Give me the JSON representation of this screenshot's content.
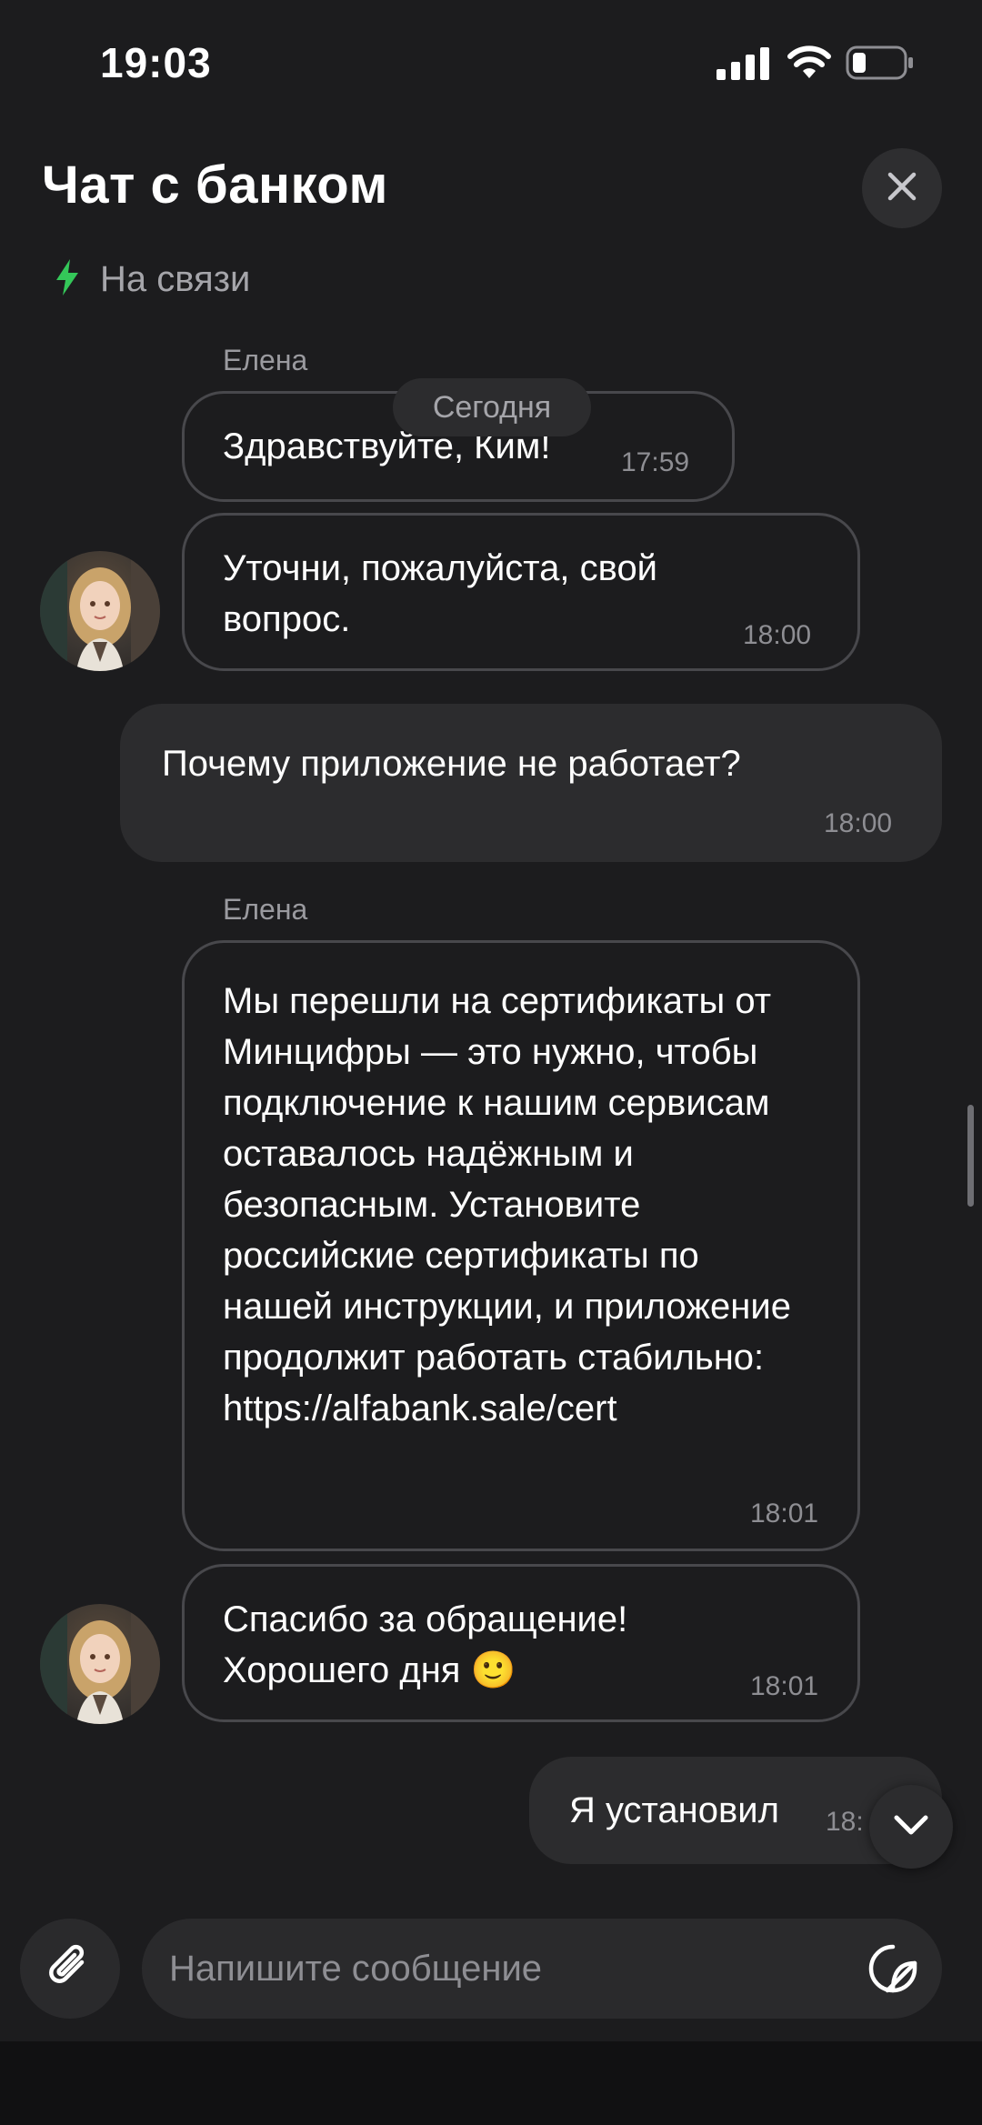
{
  "status_bar": {
    "time": "19:03"
  },
  "header": {
    "title": "Чат с банком",
    "status": "На связи"
  },
  "chat": {
    "date_chip": "Сегодня",
    "sender": "Елена",
    "messages": [
      {
        "from": "bank",
        "text": "Здравствуйте, Ким!",
        "time": "17:59"
      },
      {
        "from": "bank",
        "text": "Уточни, пожалуйста, свой вопрос.",
        "time": "18:00"
      },
      {
        "from": "me",
        "text": "Почему приложение не работает?",
        "time": "18:00"
      },
      {
        "from": "bank",
        "text": "Мы перешли на сертификаты от Минцифры — это нужно, чтобы подключение к нашим сервисам оставалось надёжным и безопасным. Установите российские сертификаты по нашей инструкции, и приложение продолжит работать стабильно: https://alfabank.sale/cert",
        "time": "18:01"
      },
      {
        "from": "bank",
        "text": "Спасибо за обращение! Хорошего дня 🙂",
        "time": "18:01"
      },
      {
        "from": "me",
        "text": "Я установил",
        "time": "18:"
      }
    ]
  },
  "composer": {
    "placeholder": "Напишите сообщение"
  },
  "colors": {
    "background": "#1c1c1e",
    "bubble_border": "#48484c",
    "my_bubble": "#2c2c2e",
    "online_icon": "#34c759"
  }
}
